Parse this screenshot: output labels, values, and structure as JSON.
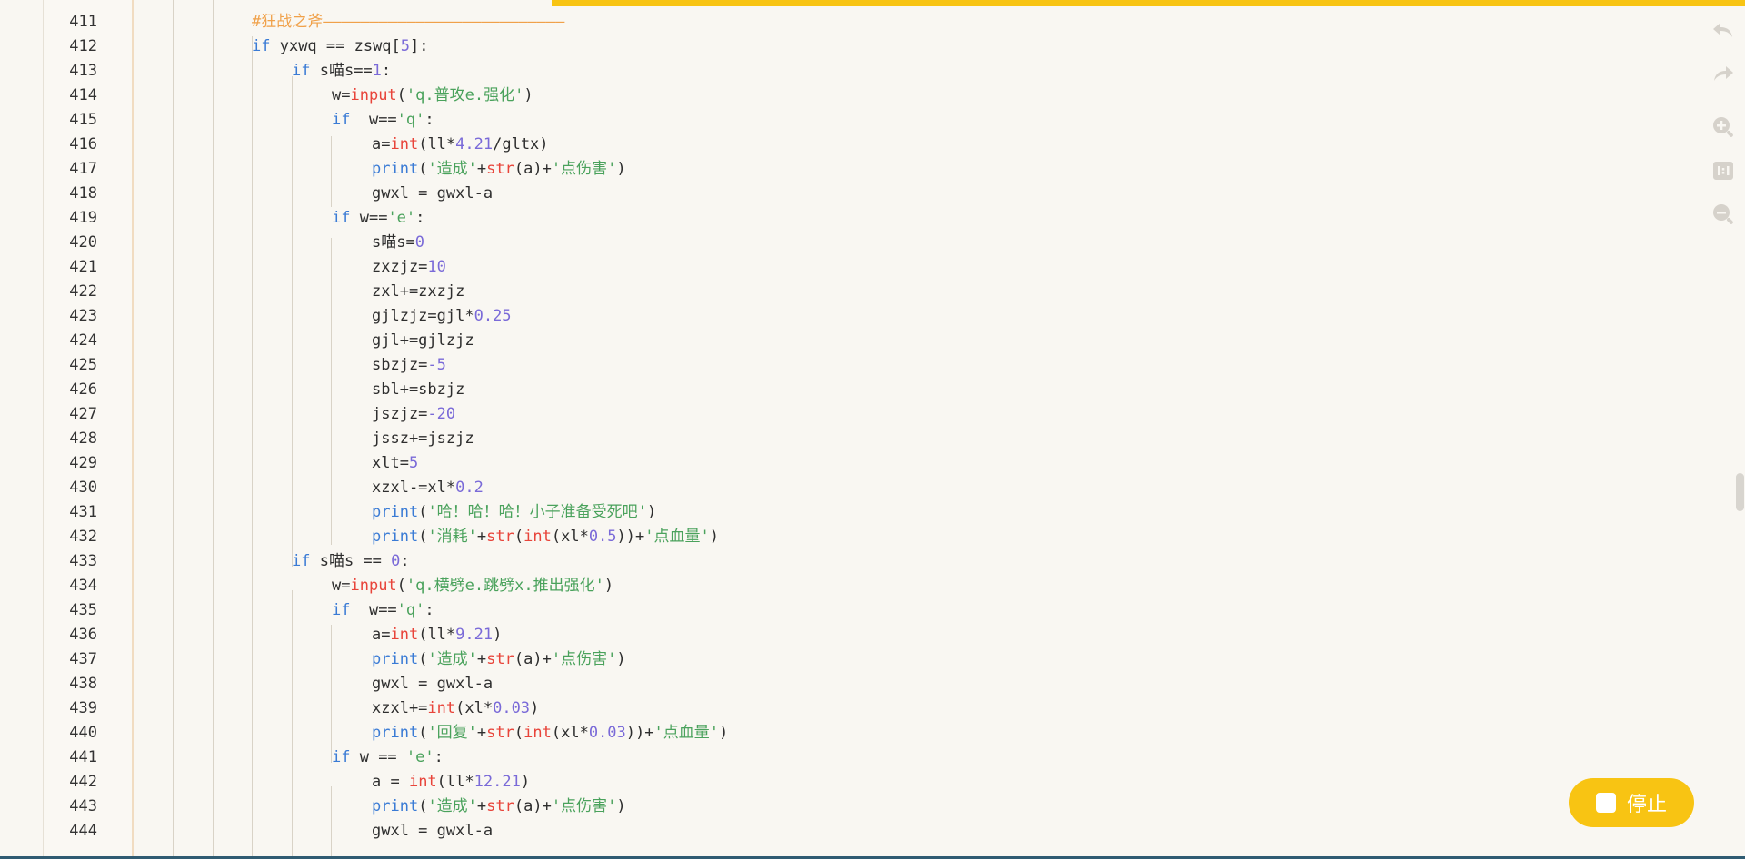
{
  "editor": {
    "lines": [
      {
        "n": "411",
        "indent": 0,
        "tokens": [
          {
            "t": "#狂战之斧——————————————————————————",
            "c": "cmt"
          }
        ]
      },
      {
        "n": "412",
        "indent": 0,
        "tokens": [
          {
            "t": "if",
            "c": "kw"
          },
          {
            "t": " yxwq == zswq[",
            "c": ""
          },
          {
            "t": "5",
            "c": "num"
          },
          {
            "t": "]:",
            "c": ""
          }
        ]
      },
      {
        "n": "413",
        "indent": 1,
        "tokens": [
          {
            "t": "if",
            "c": "kw"
          },
          {
            "t": " s喵s==",
            "c": ""
          },
          {
            "t": "1",
            "c": "num"
          },
          {
            "t": ":",
            "c": ""
          }
        ]
      },
      {
        "n": "414",
        "indent": 2,
        "tokens": [
          {
            "t": "w=",
            "c": ""
          },
          {
            "t": "input",
            "c": "fn"
          },
          {
            "t": "(",
            "c": ""
          },
          {
            "t": "'q.普攻e.强化'",
            "c": "str"
          },
          {
            "t": ")",
            "c": ""
          }
        ]
      },
      {
        "n": "415",
        "indent": 2,
        "tokens": [
          {
            "t": "if",
            "c": "kw"
          },
          {
            "t": "  w==",
            "c": ""
          },
          {
            "t": "'q'",
            "c": "str"
          },
          {
            "t": ":",
            "c": ""
          }
        ]
      },
      {
        "n": "416",
        "indent": 3,
        "tokens": [
          {
            "t": "a=",
            "c": ""
          },
          {
            "t": "int",
            "c": "fn"
          },
          {
            "t": "(ll*",
            "c": ""
          },
          {
            "t": "4.21",
            "c": "num"
          },
          {
            "t": "/gltx)",
            "c": ""
          }
        ]
      },
      {
        "n": "417",
        "indent": 3,
        "tokens": [
          {
            "t": "print",
            "c": "kw"
          },
          {
            "t": "(",
            "c": ""
          },
          {
            "t": "'造成'",
            "c": "str"
          },
          {
            "t": "+",
            "c": ""
          },
          {
            "t": "str",
            "c": "fn"
          },
          {
            "t": "(a)+",
            "c": ""
          },
          {
            "t": "'点伤害'",
            "c": "str"
          },
          {
            "t": ")",
            "c": ""
          }
        ]
      },
      {
        "n": "418",
        "indent": 3,
        "tokens": [
          {
            "t": "gwxl = gwxl-a",
            "c": ""
          }
        ]
      },
      {
        "n": "419",
        "indent": 2,
        "tokens": [
          {
            "t": "if",
            "c": "kw"
          },
          {
            "t": " w==",
            "c": ""
          },
          {
            "t": "'e'",
            "c": "str"
          },
          {
            "t": ":",
            "c": ""
          }
        ]
      },
      {
        "n": "420",
        "indent": 3,
        "tokens": [
          {
            "t": "s喵s=",
            "c": ""
          },
          {
            "t": "0",
            "c": "num"
          }
        ]
      },
      {
        "n": "421",
        "indent": 3,
        "tokens": [
          {
            "t": "zxzjz=",
            "c": ""
          },
          {
            "t": "10",
            "c": "num"
          }
        ]
      },
      {
        "n": "422",
        "indent": 3,
        "tokens": [
          {
            "t": "zxl+=zxzjz",
            "c": ""
          }
        ]
      },
      {
        "n": "423",
        "indent": 3,
        "tokens": [
          {
            "t": "gjlzjz=gjl*",
            "c": ""
          },
          {
            "t": "0.25",
            "c": "num"
          }
        ]
      },
      {
        "n": "424",
        "indent": 3,
        "tokens": [
          {
            "t": "gjl+=gjlzjz",
            "c": ""
          }
        ]
      },
      {
        "n": "425",
        "indent": 3,
        "tokens": [
          {
            "t": "sbzjz=",
            "c": ""
          },
          {
            "t": "-5",
            "c": "num"
          }
        ]
      },
      {
        "n": "426",
        "indent": 3,
        "tokens": [
          {
            "t": "sbl+=sbzjz",
            "c": ""
          }
        ]
      },
      {
        "n": "427",
        "indent": 3,
        "tokens": [
          {
            "t": "jszjz=",
            "c": ""
          },
          {
            "t": "-20",
            "c": "num"
          }
        ]
      },
      {
        "n": "428",
        "indent": 3,
        "tokens": [
          {
            "t": "jssz+=jszjz",
            "c": ""
          }
        ]
      },
      {
        "n": "429",
        "indent": 3,
        "tokens": [
          {
            "t": "xlt=",
            "c": ""
          },
          {
            "t": "5",
            "c": "num"
          }
        ]
      },
      {
        "n": "430",
        "indent": 3,
        "tokens": [
          {
            "t": "xzxl-=xl*",
            "c": ""
          },
          {
            "t": "0.2",
            "c": "num"
          }
        ]
      },
      {
        "n": "431",
        "indent": 3,
        "tokens": [
          {
            "t": "print",
            "c": "kw"
          },
          {
            "t": "(",
            "c": ""
          },
          {
            "t": "'哈！哈！哈！小子准备受死吧'",
            "c": "str"
          },
          {
            "t": ")",
            "c": ""
          }
        ]
      },
      {
        "n": "432",
        "indent": 3,
        "tokens": [
          {
            "t": "print",
            "c": "kw"
          },
          {
            "t": "(",
            "c": ""
          },
          {
            "t": "'消耗'",
            "c": "str"
          },
          {
            "t": "+",
            "c": ""
          },
          {
            "t": "str",
            "c": "fn"
          },
          {
            "t": "(",
            "c": ""
          },
          {
            "t": "int",
            "c": "fn"
          },
          {
            "t": "(xl*",
            "c": ""
          },
          {
            "t": "0.5",
            "c": "num"
          },
          {
            "t": "))+",
            "c": ""
          },
          {
            "t": "'点血量'",
            "c": "str"
          },
          {
            "t": ")",
            "c": ""
          }
        ]
      },
      {
        "n": "433",
        "indent": 1,
        "tokens": [
          {
            "t": "if",
            "c": "kw"
          },
          {
            "t": " s喵s == ",
            "c": ""
          },
          {
            "t": "0",
            "c": "num"
          },
          {
            "t": ":",
            "c": ""
          }
        ]
      },
      {
        "n": "434",
        "indent": 2,
        "tokens": [
          {
            "t": "w=",
            "c": ""
          },
          {
            "t": "input",
            "c": "fn"
          },
          {
            "t": "(",
            "c": ""
          },
          {
            "t": "'q.横劈e.跳劈x.推出强化'",
            "c": "str"
          },
          {
            "t": ")",
            "c": ""
          }
        ]
      },
      {
        "n": "435",
        "indent": 2,
        "tokens": [
          {
            "t": "if",
            "c": "kw"
          },
          {
            "t": "  w==",
            "c": ""
          },
          {
            "t": "'q'",
            "c": "str"
          },
          {
            "t": ":",
            "c": ""
          }
        ]
      },
      {
        "n": "436",
        "indent": 3,
        "tokens": [
          {
            "t": "a=",
            "c": ""
          },
          {
            "t": "int",
            "c": "fn"
          },
          {
            "t": "(ll*",
            "c": ""
          },
          {
            "t": "9.21",
            "c": "num"
          },
          {
            "t": ")",
            "c": ""
          }
        ]
      },
      {
        "n": "437",
        "indent": 3,
        "tokens": [
          {
            "t": "print",
            "c": "kw"
          },
          {
            "t": "(",
            "c": ""
          },
          {
            "t": "'造成'",
            "c": "str"
          },
          {
            "t": "+",
            "c": ""
          },
          {
            "t": "str",
            "c": "fn"
          },
          {
            "t": "(a)+",
            "c": ""
          },
          {
            "t": "'点伤害'",
            "c": "str"
          },
          {
            "t": ")",
            "c": ""
          }
        ]
      },
      {
        "n": "438",
        "indent": 3,
        "tokens": [
          {
            "t": "gwxl = gwxl-a",
            "c": ""
          }
        ]
      },
      {
        "n": "439",
        "indent": 3,
        "tokens": [
          {
            "t": "xzxl+=",
            "c": ""
          },
          {
            "t": "int",
            "c": "fn"
          },
          {
            "t": "(xl*",
            "c": ""
          },
          {
            "t": "0.03",
            "c": "num"
          },
          {
            "t": ")",
            "c": ""
          }
        ]
      },
      {
        "n": "440",
        "indent": 3,
        "tokens": [
          {
            "t": "print",
            "c": "kw"
          },
          {
            "t": "(",
            "c": ""
          },
          {
            "t": "'回复'",
            "c": "str"
          },
          {
            "t": "+",
            "c": ""
          },
          {
            "t": "str",
            "c": "fn"
          },
          {
            "t": "(",
            "c": ""
          },
          {
            "t": "int",
            "c": "fn"
          },
          {
            "t": "(xl*",
            "c": ""
          },
          {
            "t": "0.03",
            "c": "num"
          },
          {
            "t": "))+",
            "c": ""
          },
          {
            "t": "'点血量'",
            "c": "str"
          },
          {
            "t": ")",
            "c": ""
          }
        ]
      },
      {
        "n": "441",
        "indent": 2,
        "tokens": [
          {
            "t": "if",
            "c": "kw"
          },
          {
            "t": " w == ",
            "c": ""
          },
          {
            "t": "'e'",
            "c": "str"
          },
          {
            "t": ":",
            "c": ""
          }
        ]
      },
      {
        "n": "442",
        "indent": 3,
        "tokens": [
          {
            "t": "a = ",
            "c": ""
          },
          {
            "t": "int",
            "c": "fn"
          },
          {
            "t": "(ll*",
            "c": ""
          },
          {
            "t": "12.21",
            "c": "num"
          },
          {
            "t": ")",
            "c": ""
          }
        ]
      },
      {
        "n": "443",
        "indent": 3,
        "tokens": [
          {
            "t": "print",
            "c": "kw"
          },
          {
            "t": "(",
            "c": ""
          },
          {
            "t": "'造成'",
            "c": "str"
          },
          {
            "t": "+",
            "c": ""
          },
          {
            "t": "str",
            "c": "fn"
          },
          {
            "t": "(a)+",
            "c": ""
          },
          {
            "t": "'点伤害'",
            "c": "str"
          },
          {
            "t": ")",
            "c": ""
          }
        ]
      },
      {
        "n": "444",
        "indent": 3,
        "tokens": [
          {
            "t": "gwxl = gwxl-a",
            "c": ""
          }
        ]
      }
    ]
  },
  "toolbar": {
    "icons": [
      "undo-icon",
      "redo-icon",
      "zoom-in-icon",
      "actual-size-icon",
      "zoom-out-icon"
    ]
  },
  "stop_button": {
    "label": "停止"
  },
  "colors": {
    "accent": "#f8c413",
    "keyword": "#3a7bd5",
    "function": "#e8443a",
    "string": "#4aa25c",
    "number": "#7a6ad8",
    "comment": "#f0a14a"
  }
}
